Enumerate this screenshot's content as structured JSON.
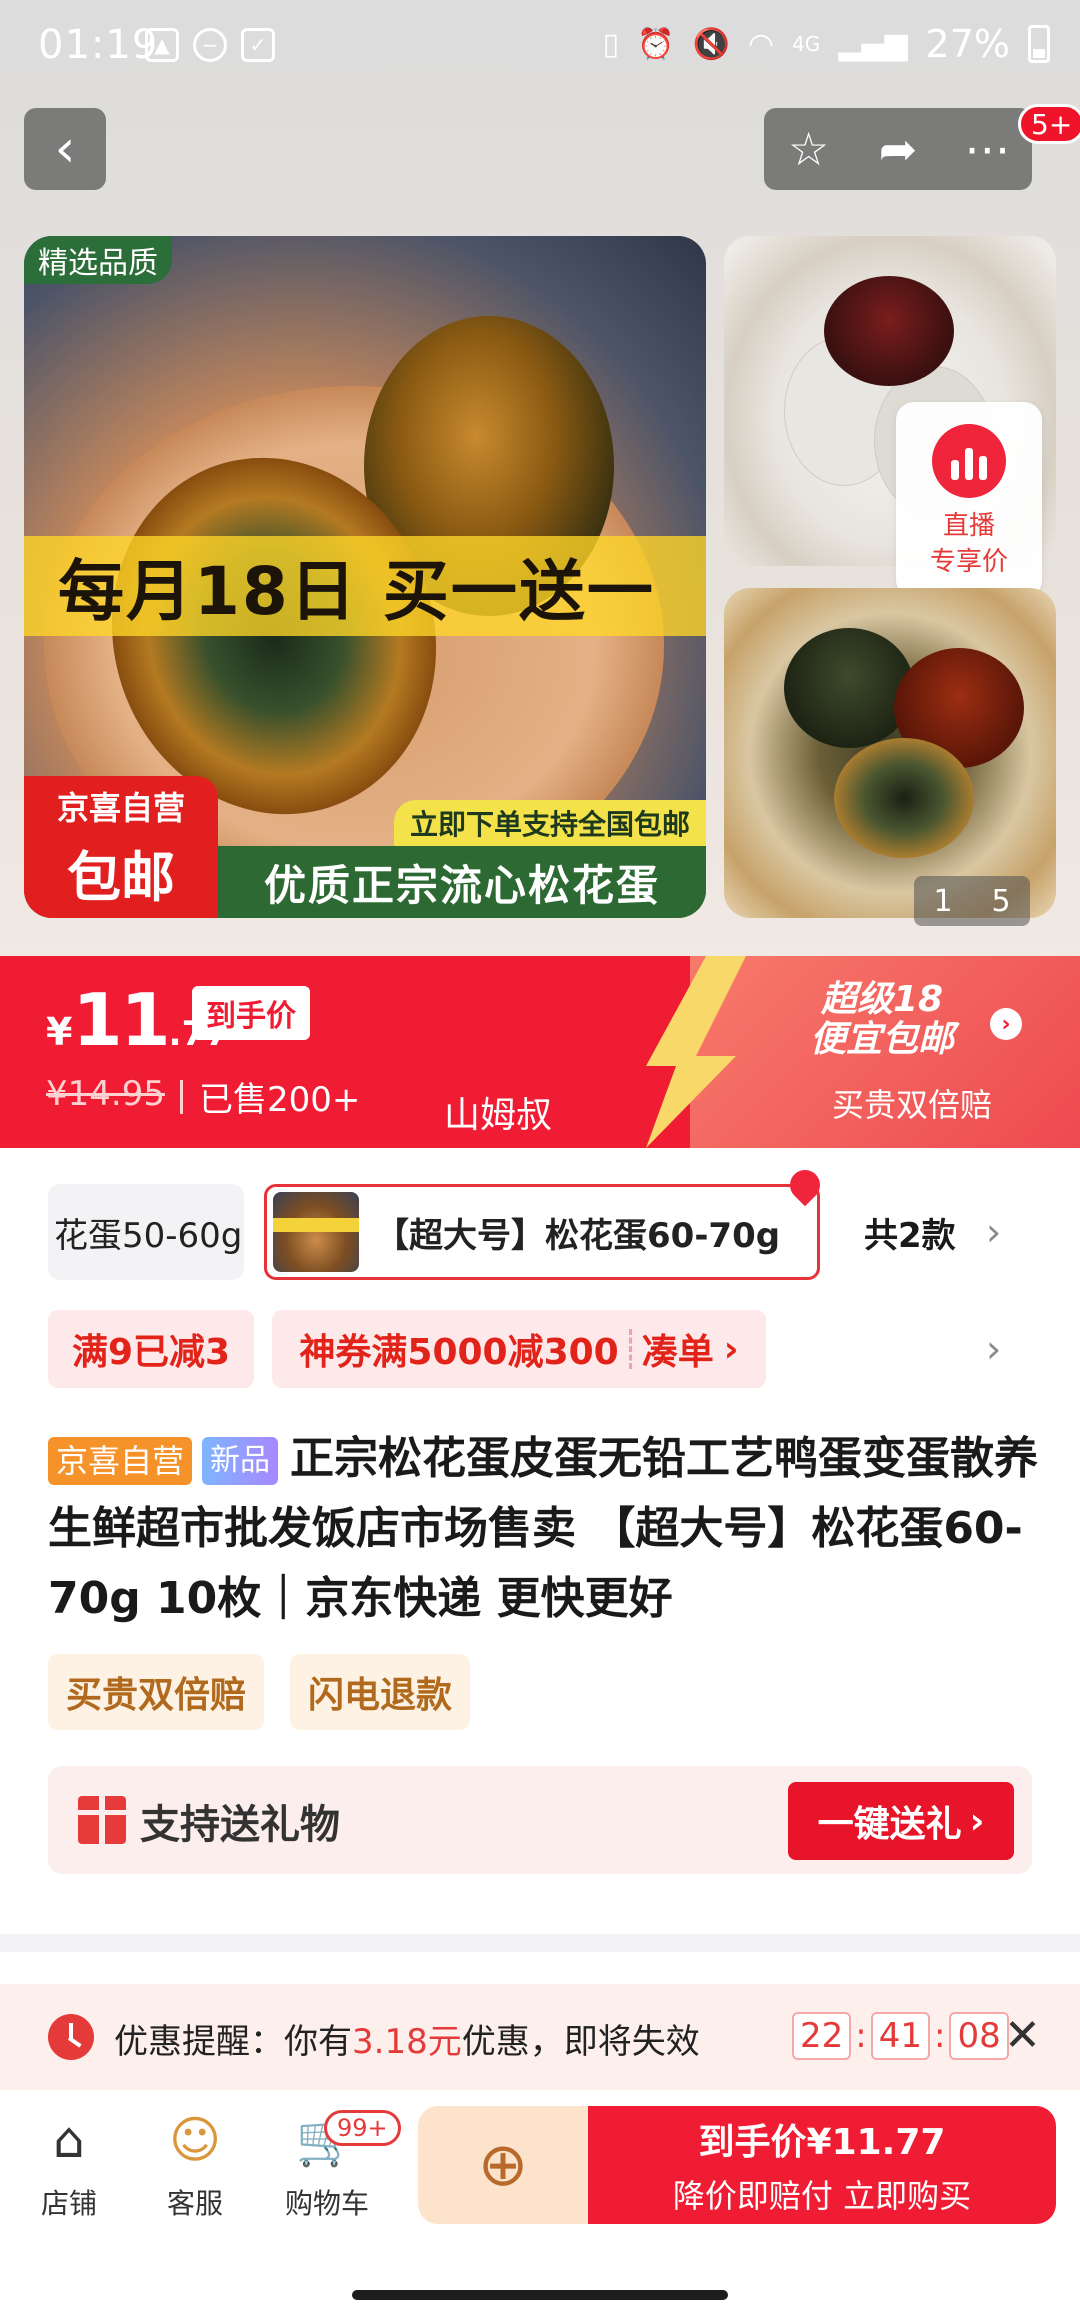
{
  "status_bar": {
    "time": "01:19",
    "battery": "27%",
    "network": "4G"
  },
  "header": {
    "cart_badge": "5+"
  },
  "gallery": {
    "corner_tag": "精选品质",
    "banner_text": "每月18日 买一送一",
    "red_tag_line1": "京喜自营",
    "red_tag_line2": "包邮",
    "yellow_tag": "立即下单支持全国包邮",
    "green_tag": "优质正宗流心松花蛋",
    "live_label_1": "直播",
    "live_label_2": "专享价",
    "pager_current": "1",
    "pager_total": "5"
  },
  "price": {
    "currency": "¥",
    "integer": "11",
    "decimal": ".77",
    "tag": "到手价",
    "original": "¥14.95",
    "sold": "已售200+",
    "shop": "山姆叔",
    "promo_line1": "超级18",
    "promo_line2": "便宜包邮",
    "promo_sub": "买贵双倍赔"
  },
  "specs": {
    "option_a": "花蛋50-60g",
    "option_b": "【超大号】松花蛋60-70g",
    "count": "共2款"
  },
  "coupons": {
    "c1": "满9已减3",
    "c2": "神券满5000减300",
    "c2_action": "凑单"
  },
  "product": {
    "badge_self": "京喜自营",
    "badge_new": "新品",
    "title": "正宗松花蛋皮蛋无铅工艺鸭蛋变蛋散养生鲜超市批发饭店市场售卖 【超大号】松花蛋60-70g 10枚｜京东快递 更快更好"
  },
  "services": [
    "买贵双倍赔",
    "闪电退款"
  ],
  "gift": {
    "text": "支持送礼物",
    "button": "一键送礼"
  },
  "reminder": {
    "prefix": "优惠提醒：你有",
    "amount": "3.18元",
    "suffix": "优惠，即将失效",
    "hh": "22",
    "mm": "41",
    "ss": "08"
  },
  "bottom_nav": {
    "store": "店铺",
    "service": "客服",
    "cart": "购物车",
    "cart_badge": "99+",
    "buy_line1": "到手价¥11.77",
    "buy_line2": "降价即赔付 立即购买"
  }
}
